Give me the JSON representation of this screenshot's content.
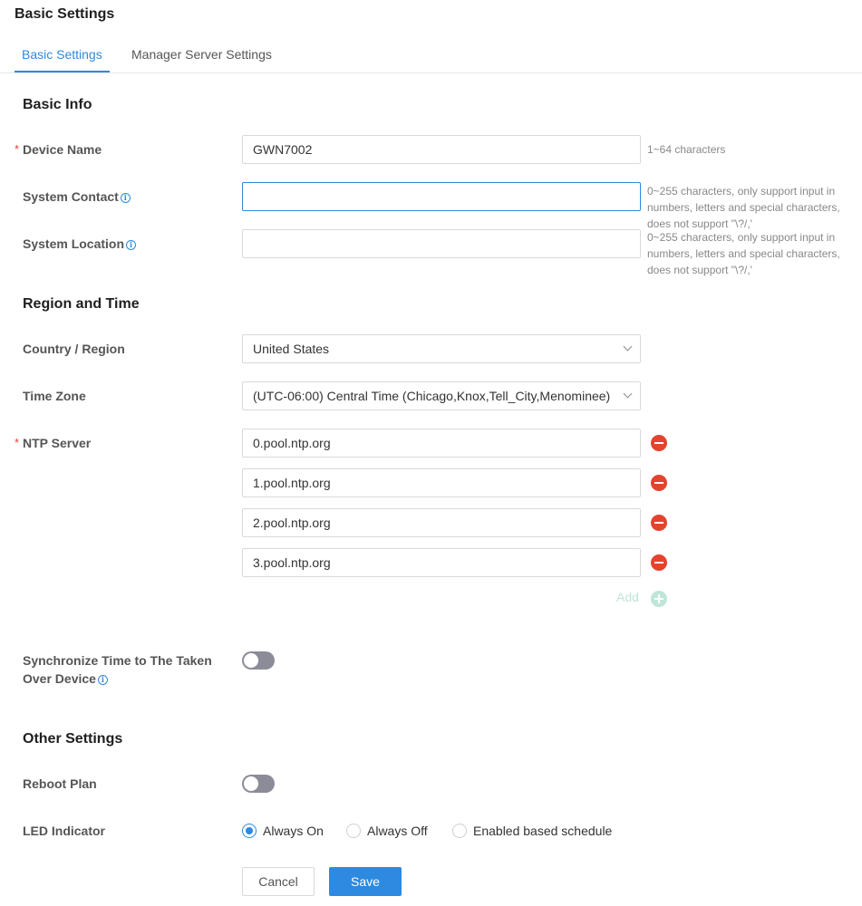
{
  "page": {
    "title": "Basic Settings"
  },
  "tabs": [
    {
      "label": "Basic Settings",
      "active": true
    },
    {
      "label": "Manager Server Settings",
      "active": false
    }
  ],
  "basic_info": {
    "title": "Basic Info",
    "device_name": {
      "label": "Device Name",
      "required": "*",
      "value": "GWN7002",
      "hint": "1~64 characters"
    },
    "system_contact": {
      "label": "System Contact",
      "info": "i",
      "value": "",
      "hint": "0~255 characters, only support input in numbers, letters and special characters, does not support \"\\?/,'"
    },
    "system_location": {
      "label": "System Location",
      "info": "i",
      "value": "",
      "hint": "0~255 characters, only support input in numbers, letters and special characters, does not support \"\\?/,'"
    }
  },
  "region_time": {
    "title": "Region and Time",
    "country": {
      "label": "Country / Region",
      "value": "United States"
    },
    "time_zone": {
      "label": "Time Zone",
      "value": "(UTC-06:00) Central Time (Chicago,Knox,Tell_City,Menominee)"
    },
    "ntp": {
      "label": "NTP Server",
      "required": "*",
      "servers": [
        "0.pool.ntp.org",
        "1.pool.ntp.org",
        "2.pool.ntp.org",
        "3.pool.ntp.org"
      ],
      "add_label": "Add"
    },
    "sync": {
      "label_line1": "Synchronize Time to The Taken",
      "label_line2": "Over Device",
      "info": "i",
      "enabled": false
    }
  },
  "other_settings": {
    "title": "Other Settings",
    "reboot_plan": {
      "label": "Reboot Plan",
      "enabled": false
    },
    "led": {
      "label": "LED Indicator",
      "options": [
        "Always On",
        "Always Off",
        "Enabled based schedule"
      ],
      "selected": "Always On"
    }
  },
  "actions": {
    "cancel": "Cancel",
    "save": "Save"
  },
  "colors": {
    "accent": "#2d8ae0",
    "danger": "#e5432f",
    "add_disabled": "#bfe6d8",
    "toggle_off": "#8c8c99"
  }
}
